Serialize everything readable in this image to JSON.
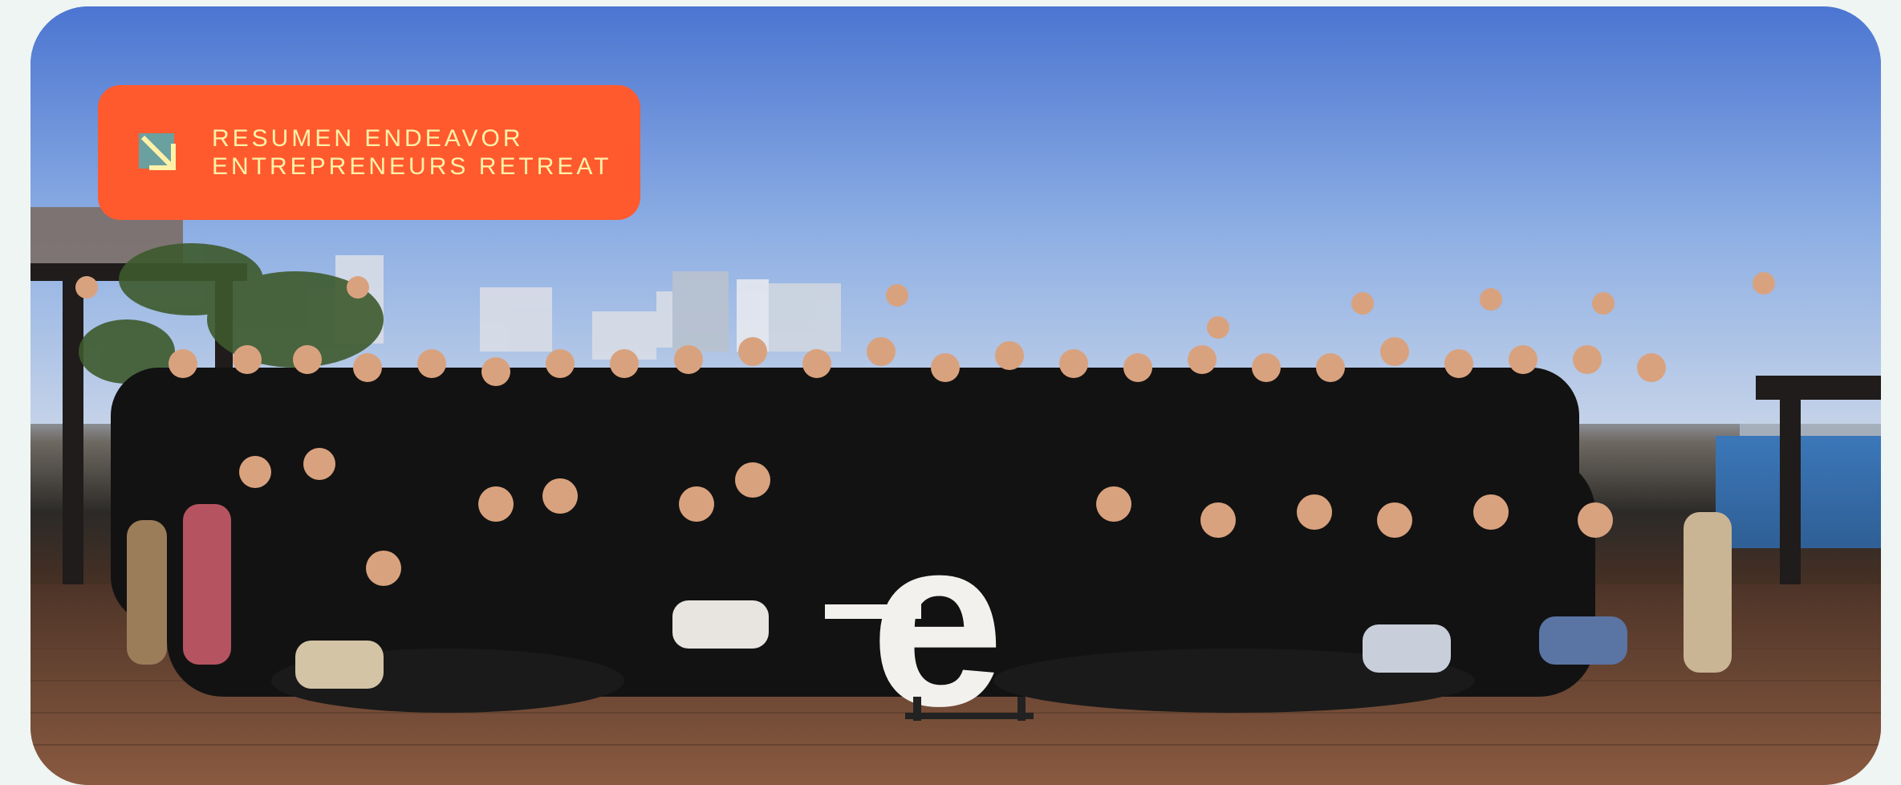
{
  "banner": {
    "line1": "RESUMEN ENDEAVOR",
    "line2": "ENTREPRENEURS RETREAT",
    "icon": "arrow-down-right-icon",
    "background_color": "#ff5a2e",
    "text_color": "#fff2a8"
  },
  "photo": {
    "logo_letter": "e"
  }
}
